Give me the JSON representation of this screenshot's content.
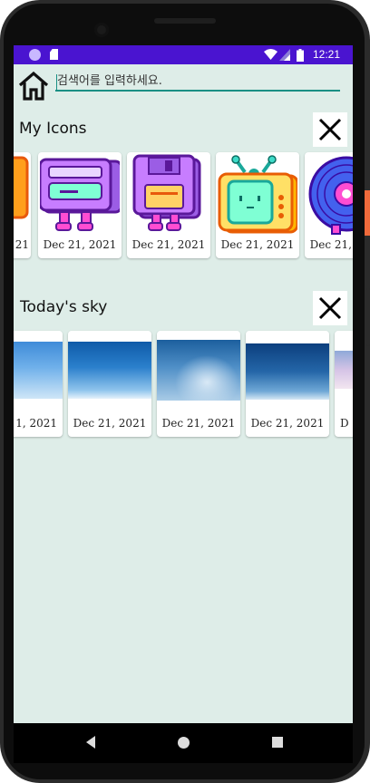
{
  "status_bar": {
    "time": "12:21"
  },
  "search": {
    "placeholder": "검색어를 입력하세요."
  },
  "sections": [
    {
      "title": "My Icons",
      "cards": [
        {
          "date": "21",
          "icon": "orange-partial-icon"
        },
        {
          "date": "Dec 21, 2021",
          "icon": "purple-cassette-robot-icon"
        },
        {
          "date": "Dec 21, 2021",
          "icon": "floppy-disk-robot-icon"
        },
        {
          "date": "Dec 21, 2021",
          "icon": "tv-robot-icon"
        },
        {
          "date": "Dec 21, 2021",
          "icon": "vinyl-record-robot-icon"
        }
      ]
    },
    {
      "title": "Today's sky",
      "cards": [
        {
          "date": "1, 2021"
        },
        {
          "date": "Dec 21, 2021"
        },
        {
          "date": "Dec 21, 2021"
        },
        {
          "date": "Dec 21, 2021"
        },
        {
          "date": "D"
        }
      ]
    }
  ],
  "colors": {
    "status_bar": "#4a14d0",
    "background": "#deede8",
    "search_underline": "#1a8f84"
  }
}
